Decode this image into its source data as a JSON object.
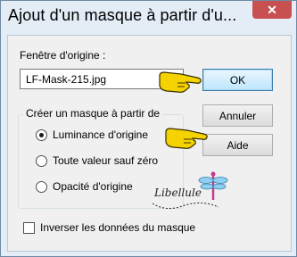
{
  "window": {
    "title": "Ajout d'un masque à partir d'u...",
    "close_glyph": "✕"
  },
  "source": {
    "label": "Fenêtre d'origine :",
    "value": "LF-Mask-215.jpg"
  },
  "buttons": {
    "ok": "OK",
    "cancel": "Annuler",
    "help": "Aide"
  },
  "create_group": {
    "title": "Créer un masque à partir de",
    "options": [
      {
        "label": "Luminance d'origine",
        "selected": true
      },
      {
        "label": "Toute valeur sauf zéro",
        "selected": false
      },
      {
        "label": "Opacité d'origine",
        "selected": false
      }
    ]
  },
  "invert": {
    "label": "Inverser les données du masque",
    "checked": false
  },
  "annotation": {
    "signature": "Libellule",
    "pointer_icon": "pointing-hand-icon",
    "hand_color": "#f5d300"
  },
  "colors": {
    "close_button": "#c75050",
    "default_button_border": "#3c7fb1"
  }
}
